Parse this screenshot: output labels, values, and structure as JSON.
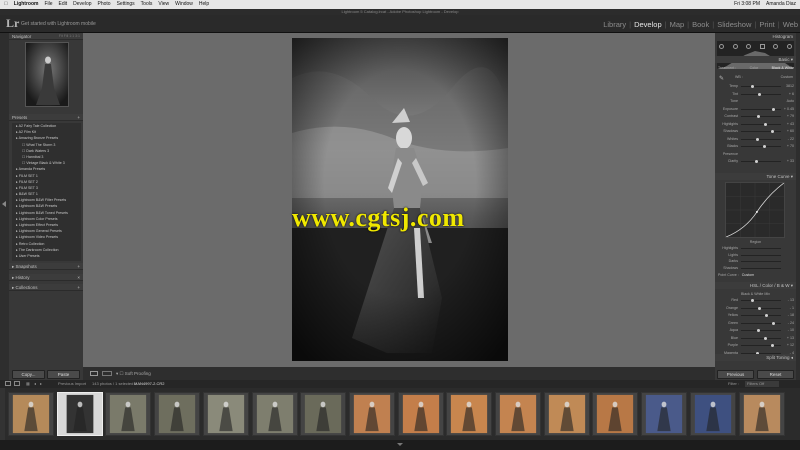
{
  "menubar": {
    "apple": "",
    "items": [
      "Lightroom",
      "File",
      "Edit",
      "Develop",
      "Photo",
      "Settings",
      "Tools",
      "View",
      "Window",
      "Help"
    ],
    "right": [
      "Fri 3:08 PM",
      "Amanda Diaz"
    ]
  },
  "window_title": "Lightroom 5 Catalog.lrcat - Adobe Photoshop Lightroom - Develop",
  "identity": {
    "logo": "Lr",
    "text": "Get started with Lightroom mobile",
    "modules": [
      "Library",
      "Develop",
      "Map",
      "Book",
      "Slideshow",
      "Print",
      "Web"
    ],
    "active_module": "Develop"
  },
  "left_panel": {
    "navigator": {
      "title": "Navigator",
      "zoom": [
        "Fit",
        "Fill",
        "1:1",
        "3:1"
      ]
    },
    "presets_title": "Presets",
    "presets": [
      "A2 Fairy Tale Collection",
      "A2 Film Kit",
      "Amazing Bronze Presets",
      "What The Storm 3",
      "Dark Waters 3",
      "Hannibal 3",
      "Vintage Black & White 3",
      "Amanda Presets",
      "FILM SET 1",
      "FILM SET 2",
      "FILM SET 3",
      "B&W SET 1",
      "Lightroom B&W Filter Presets",
      "Lightroom B&W Presets",
      "Lightroom B&W Toned Presets",
      "Lightroom Color Presets",
      "Lightroom Effect Presets",
      "Lightroom General Presets",
      "Lightroom Video Presets",
      "Retro Collection",
      "The Darkroom Collection",
      "User Presets"
    ],
    "snapshots": "Snapshots",
    "history": "History",
    "collections": "Collections",
    "copy_btn": "Copy...",
    "paste_btn": "Paste"
  },
  "toolbar": {
    "soft_proofing": "Soft Proofing"
  },
  "watermark": "www.cgtsj.com",
  "right_panel": {
    "histogram": "Histogram",
    "basic": "Basic",
    "treatment": "Treatment :",
    "color": "Color",
    "bw": "Black & White",
    "wb": "WB :",
    "wb_value": "Custom",
    "sliders_basic": [
      {
        "label": "Temp",
        "value": "3812"
      },
      {
        "label": "Tint",
        "value": "+ 6"
      },
      {
        "label": "Tone",
        "value": "Auto"
      },
      {
        "label": "Exposure",
        "value": "+ 0.45"
      },
      {
        "label": "Contrast",
        "value": "+ 79"
      },
      {
        "label": "Highlights",
        "value": "+ 43"
      },
      {
        "label": "Shadows",
        "value": "+ 60"
      },
      {
        "label": "Whites",
        "value": "- 22"
      },
      {
        "label": "Blacks",
        "value": "+ 70"
      },
      {
        "label": "Presence",
        "value": ""
      },
      {
        "label": "Clarity",
        "value": "+ 33"
      }
    ],
    "tone_curve": "Tone Curve",
    "region": "Region",
    "region_items": [
      "Highlights",
      "Lights",
      "Darks",
      "Shadows"
    ],
    "point_curve_label": "Point Curve :",
    "point_curve_value": "Custom",
    "hsl": "HSL / Color / B & W",
    "bw_mix": "Black & White Mix",
    "bw_sliders": [
      {
        "label": "Red",
        "value": "- 13"
      },
      {
        "label": "Orange",
        "value": "- 1"
      },
      {
        "label": "Yellow",
        "value": "- 18"
      },
      {
        "label": "Green",
        "value": "- 24"
      },
      {
        "label": "Aqua",
        "value": "- 10"
      },
      {
        "label": "Blue",
        "value": "+ 13"
      },
      {
        "label": "Purple",
        "value": "+ 12"
      },
      {
        "label": "Magenta",
        "value": "- 4"
      }
    ],
    "split_toning": "Split Toning",
    "previous_btn": "Previous",
    "reset_btn": "Reset"
  },
  "filmstrip_bar": {
    "source": "Previous Import",
    "count": "143 photos / 1 selected /",
    "filename": "MAN4997-2.CR2",
    "filter_label": "Filter :",
    "filter_value": "Filters Off"
  },
  "colors": {
    "accent": "#e6e6e6",
    "bg": "#6b6b6b",
    "panel": "#383838",
    "watermark": "#f0e800"
  }
}
